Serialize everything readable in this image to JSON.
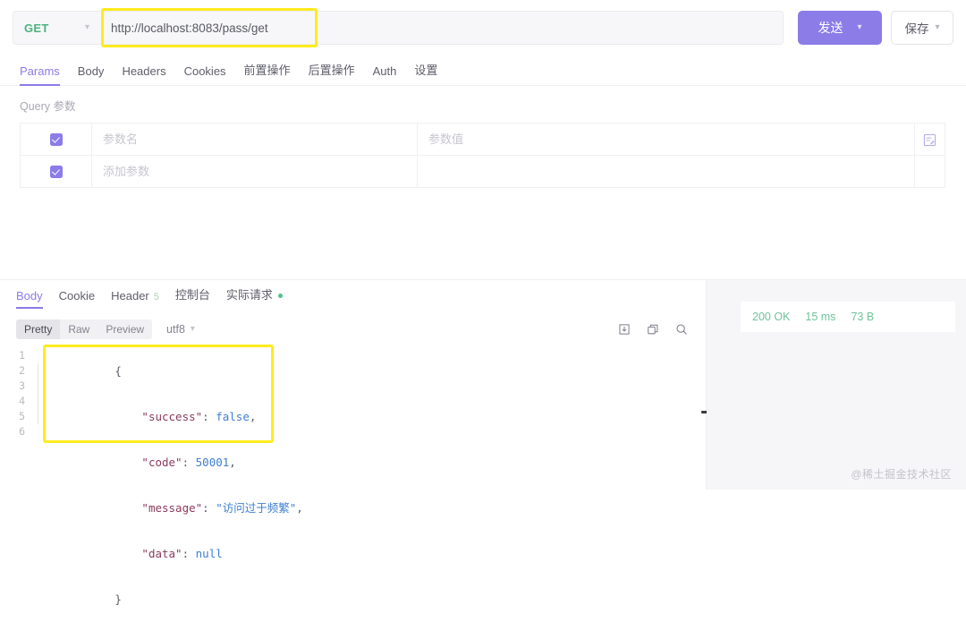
{
  "request": {
    "method": "GET",
    "method_dropdown_icon": "chevron-down-icon",
    "url_value": "http://localhost:8083/pass/get",
    "url_placeholder": "http://localhost:8083/pass/get",
    "send_label": "发送",
    "send_dropdown_icon": "chevron-down-icon",
    "save_label": "保存",
    "save_dropdown_icon": "chevron-down-icon",
    "accent_color": "#8b7ce8",
    "method_color": "#4cb37f",
    "highlight_color": "#ffeb1f"
  },
  "request_tabs": [
    {
      "label": "Params",
      "active": true
    },
    {
      "label": "Body",
      "active": false
    },
    {
      "label": "Headers",
      "active": false
    },
    {
      "label": "Cookies",
      "active": false
    },
    {
      "label": "前置操作",
      "active": false
    },
    {
      "label": "后置操作",
      "active": false
    },
    {
      "label": "Auth",
      "active": false
    },
    {
      "label": "设置",
      "active": false
    }
  ],
  "query_params": {
    "title": "Query 参数",
    "batch_edit_icon": "batch-edit-icon",
    "rows": [
      {
        "checked": true,
        "key_placeholder": "参数名",
        "key_value": "",
        "value_placeholder": "参数值",
        "value_value": ""
      },
      {
        "checked": true,
        "key_placeholder": "添加参数",
        "key_value": "",
        "value_placeholder": "",
        "value_value": ""
      }
    ]
  },
  "response_tabs": [
    {
      "label": "Body",
      "active": true,
      "badge": "",
      "dot": false
    },
    {
      "label": "Cookie",
      "active": false,
      "badge": "",
      "dot": false
    },
    {
      "label": "Header",
      "active": false,
      "badge": "5",
      "dot": false
    },
    {
      "label": "控制台",
      "active": false,
      "badge": "",
      "dot": false
    },
    {
      "label": "实际请求",
      "active": false,
      "badge": "",
      "dot": true
    }
  ],
  "format_bar": {
    "modes": [
      {
        "label": "Pretty",
        "active": true
      },
      {
        "label": "Raw",
        "active": false
      },
      {
        "label": "Preview",
        "active": false
      }
    ],
    "encoding": "utf8",
    "encoding_icon": "chevron-down-icon",
    "icons": [
      "download-icon",
      "copy-icon",
      "search-icon"
    ]
  },
  "code": {
    "line_numbers": [
      "1",
      "2",
      "3",
      "4",
      "5",
      "6"
    ],
    "lines": [
      {
        "indent": 0,
        "parts": [
          {
            "t": "{",
            "c": "brace"
          }
        ]
      },
      {
        "indent": 1,
        "parts": [
          {
            "t": "\"success\"",
            "c": "key"
          },
          {
            "t": ": ",
            "c": "punc"
          },
          {
            "t": "false",
            "c": "val"
          },
          {
            "t": ",",
            "c": "punc"
          }
        ]
      },
      {
        "indent": 1,
        "parts": [
          {
            "t": "\"code\"",
            "c": "key"
          },
          {
            "t": ": ",
            "c": "punc"
          },
          {
            "t": "50001",
            "c": "val"
          },
          {
            "t": ",",
            "c": "punc"
          }
        ]
      },
      {
        "indent": 1,
        "parts": [
          {
            "t": "\"message\"",
            "c": "key"
          },
          {
            "t": ": ",
            "c": "punc"
          },
          {
            "t": "\"访问过于频繁\"",
            "c": "val"
          },
          {
            "t": ",",
            "c": "punc"
          }
        ]
      },
      {
        "indent": 1,
        "parts": [
          {
            "t": "\"data\"",
            "c": "key"
          },
          {
            "t": ": ",
            "c": "punc"
          },
          {
            "t": "null",
            "c": "val"
          }
        ]
      },
      {
        "indent": 0,
        "parts": [
          {
            "t": "}",
            "c": "brace"
          }
        ]
      }
    ]
  },
  "status": {
    "code": "200 OK",
    "time": "15 ms",
    "size": "73 B",
    "color": "#6fc39a"
  },
  "watermark": "@稀土掘金技术社区"
}
